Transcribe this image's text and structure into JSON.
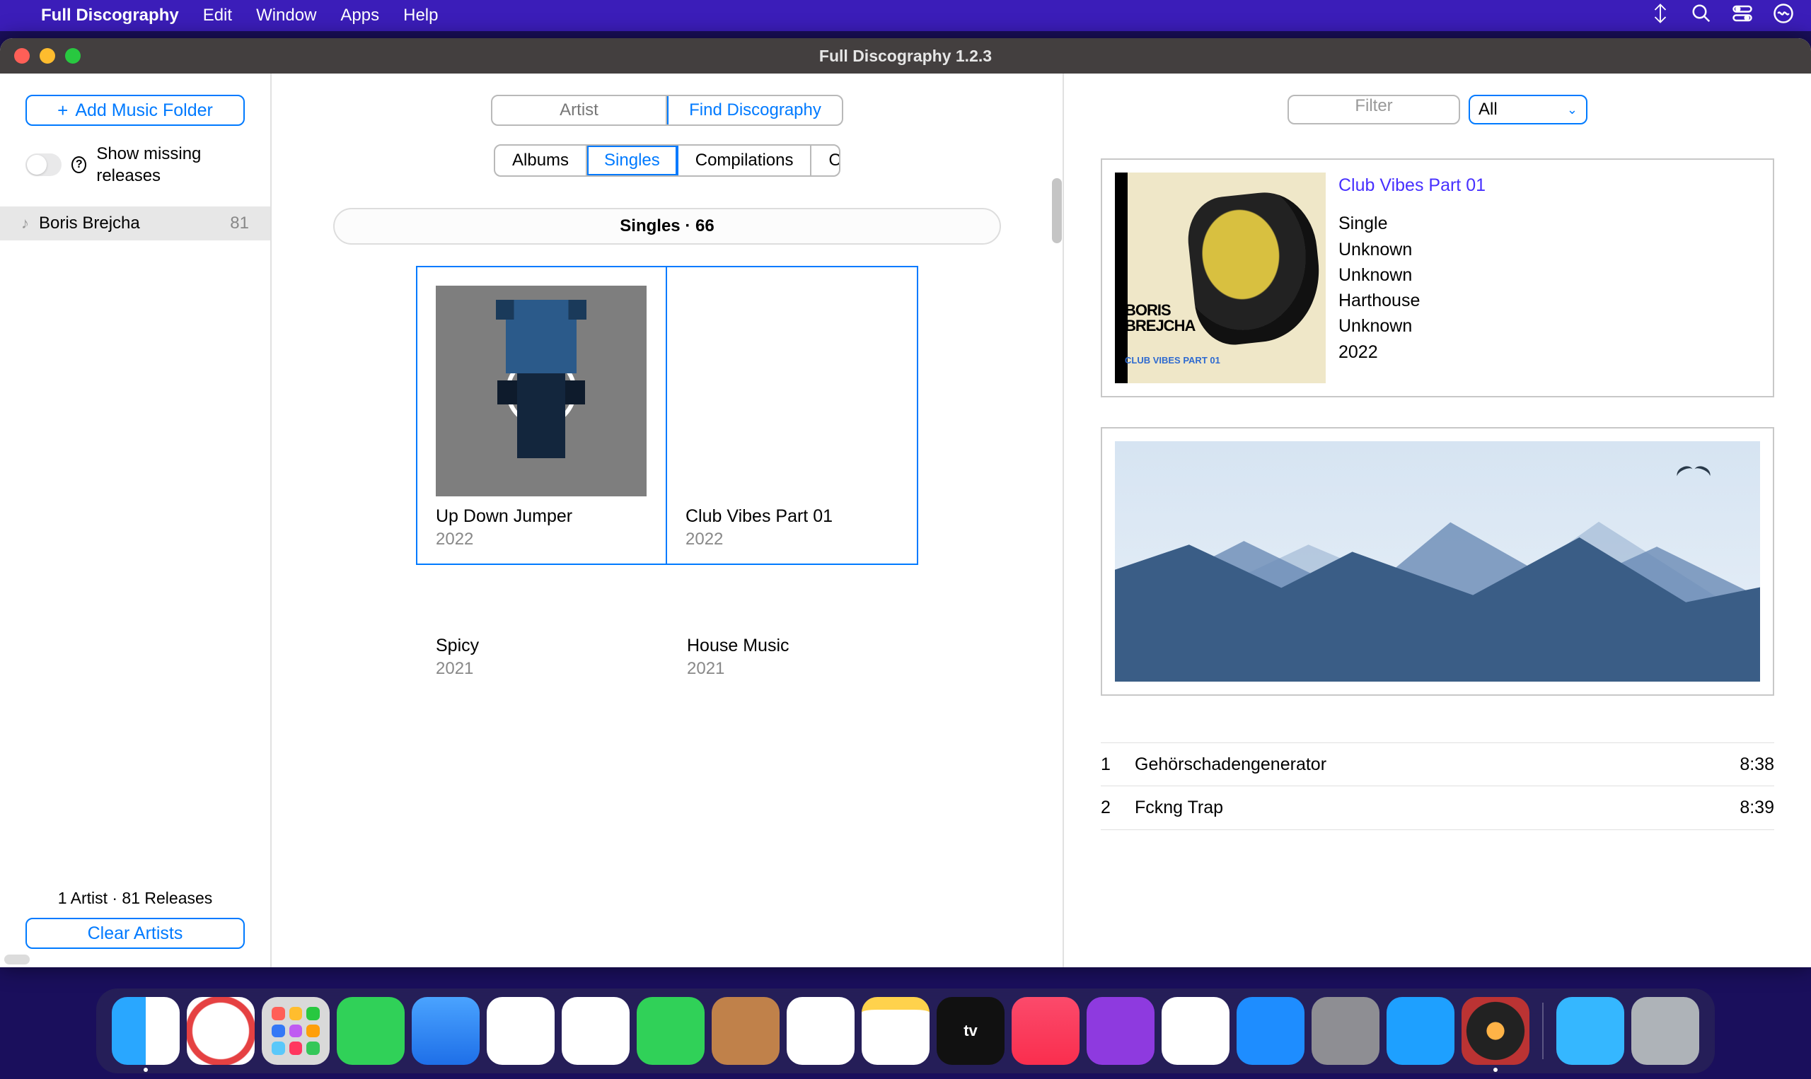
{
  "menubar": {
    "app_name": "Full Discography",
    "items": [
      "Edit",
      "Window",
      "Apps",
      "Help"
    ]
  },
  "window": {
    "title": "Full Discography 1.2.3"
  },
  "sidebar": {
    "add_button": "Add Music Folder",
    "toggle_label": "Show missing releases",
    "artists": [
      {
        "name": "Boris Brejcha",
        "count": "81"
      }
    ],
    "summary": "1 Artist · 81 Releases",
    "clear_button": "Clear Artists"
  },
  "middle": {
    "seg_main": {
      "artist": "Artist",
      "find": "Find Discography"
    },
    "seg_types": [
      "Albums",
      "Singles",
      "Compilations",
      "Other"
    ],
    "active_type": "Singles",
    "pill": "Singles · 66",
    "releases": [
      {
        "name": "Up Down Jumper",
        "year": "2022"
      },
      {
        "name": "Club Vibes Part 01",
        "year": "2022"
      },
      {
        "name": "Spicy",
        "year": "2021"
      },
      {
        "name": "House Music",
        "year": "2021"
      }
    ]
  },
  "right": {
    "filter_placeholder": "Filter",
    "filter_select": "All",
    "info": {
      "title": "Club Vibes Part 01",
      "cover_artist_line1": "BORIS",
      "cover_artist_line2": "BREJCHA",
      "cover_sub": "CLUB VIBES\nPART 01",
      "meta": [
        "Single",
        "Unknown",
        "Unknown",
        "Harthouse",
        "Unknown",
        "2022"
      ]
    },
    "tracks": [
      {
        "n": "1",
        "name": "Gehörschadengenerator",
        "dur": "8:38"
      },
      {
        "n": "2",
        "name": "Fckng Trap",
        "dur": "8:39"
      }
    ]
  },
  "dock": {
    "apps": [
      "Finder",
      "Safari",
      "Launchpad",
      "Messages",
      "Mail",
      "Maps",
      "Photos",
      "FaceTime",
      "Contacts",
      "Reminders",
      "Notes",
      "TV",
      "Music",
      "Podcasts",
      "News",
      "App Store",
      "System Settings",
      "Xcode",
      "Full Discography"
    ],
    "tv_label": "tv",
    "right": [
      "Downloads",
      "Trash"
    ]
  }
}
